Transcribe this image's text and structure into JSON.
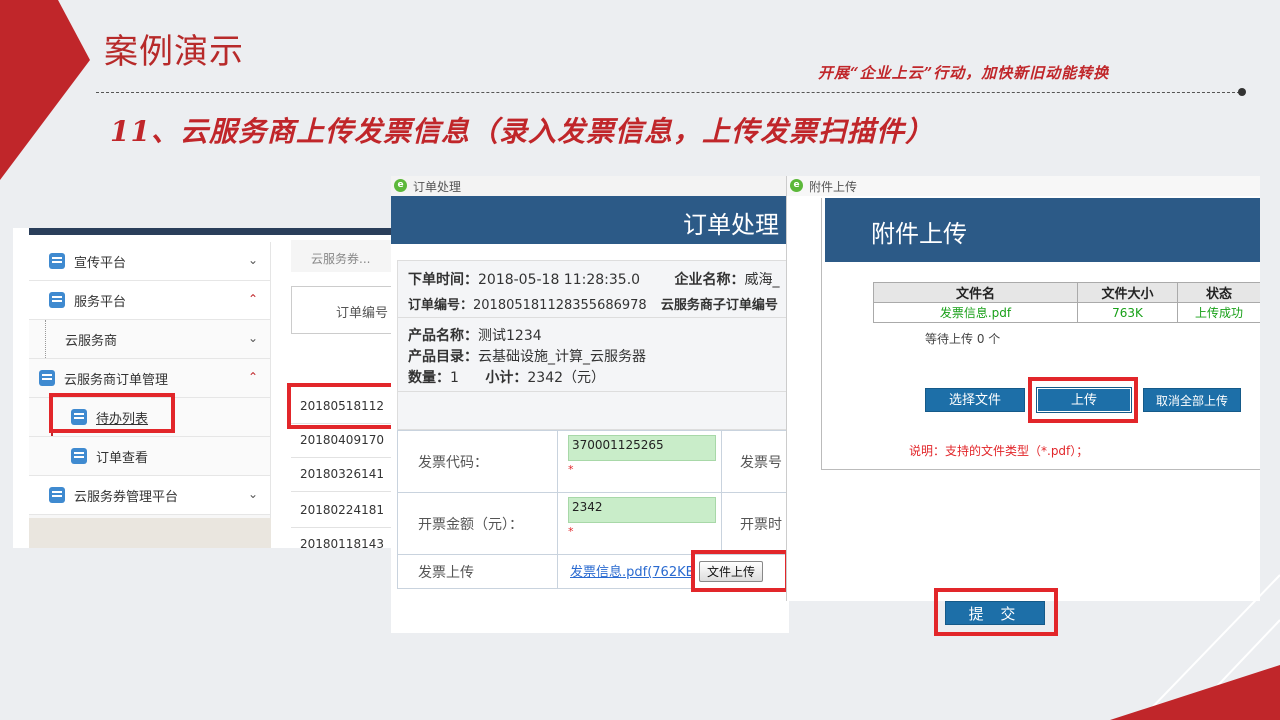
{
  "slide": {
    "title": "案例演示",
    "slogan": "开展“企业上云”行动，加快新旧动能转换",
    "subtitle": "11、云服务商上传发票信息（录入发票信息，上传发票扫描件）",
    "colors": {
      "accent": "#c0262a",
      "banner": "#2c5a87",
      "highlight": "#e2262a"
    }
  },
  "sidebar": {
    "items": [
      {
        "label": "宣传平台",
        "icon": "doc-icon",
        "chevron": "chevron-down"
      },
      {
        "label": "服务平台",
        "icon": "doc-icon",
        "chevron": "chevron-up"
      },
      {
        "label": "云服务商",
        "icon": "",
        "chevron": "chevron-down"
      },
      {
        "label": "云服务商订单管理",
        "icon": "doc-icon",
        "chevron": "chevron-up"
      },
      {
        "label": "待办列表",
        "icon": "doc-icon",
        "chevron": ""
      },
      {
        "label": "订单查看",
        "icon": "doc-icon",
        "chevron": ""
      },
      {
        "label": "云服务券管理平台",
        "icon": "doc-icon",
        "chevron": "chevron-down"
      }
    ]
  },
  "order_list": {
    "breadcrumb": "云服务券...",
    "header": "订单编号",
    "rows": [
      "20180518112",
      "20180409170",
      "20180326141",
      "20180224181",
      "20180118143"
    ]
  },
  "order_window": {
    "window_title": "订单处理",
    "banner": "订单处理",
    "order_time_label": "下单时间：",
    "order_time": "2018-05-18 11:28:35.0",
    "company_label": "企业名称：",
    "company": "威海_",
    "order_no_label": "订单编号：",
    "order_no": "201805181128355686978",
    "sub_order_label": "云服务商子订单编号",
    "product_name_label": "产品名称：",
    "product_name": "测试1234",
    "product_cat_label": "产品目录：",
    "product_cat": "云基础设施_计算_云服务器",
    "qty_label": "数量：",
    "qty": "1",
    "subtotal_label": "小计：",
    "subtotal": "2342（元）",
    "invoice_code_label": "发票代码：",
    "invoice_code": "370001125265",
    "invoice_no_label": "发票号",
    "amount_label": "开票金额（元）：",
    "amount": "2342",
    "invoice_time_label": "开票时",
    "required_mark": "*",
    "upload_label": "发票上传",
    "file_link": "发票信息.pdf(762KB",
    "upload_btn": "文件上传"
  },
  "attach_window": {
    "window_title": "附件上传",
    "banner": "附件上传",
    "columns": [
      "文件名",
      "文件大小",
      "状态"
    ],
    "file": {
      "name": "发票信息.pdf",
      "size": "763K",
      "status": "上传成功"
    },
    "waiting": "等待上传 0 个",
    "select_btn": "选择文件",
    "upload_btn": "上传",
    "cancel_btn": "取消全部上传",
    "note": "说明：支持的文件类型（*.pdf）；",
    "submit_btn": "提 交"
  }
}
